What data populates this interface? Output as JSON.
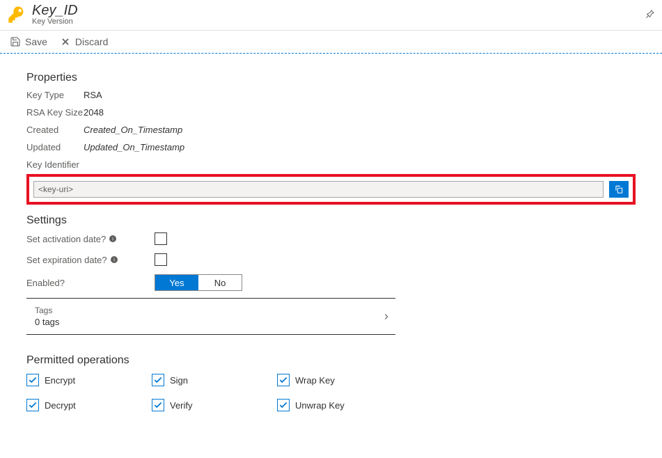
{
  "header": {
    "title": "Key_ID",
    "subtitle": "Key Version"
  },
  "toolbar": {
    "save": "Save",
    "discard": "Discard"
  },
  "properties": {
    "heading": "Properties",
    "key_type_label": "Key Type",
    "key_type_value": "RSA",
    "rsa_size_label": "RSA Key Size",
    "rsa_size_value": "2048",
    "created_label": "Created",
    "created_value": "Created_On_Timestamp",
    "updated_label": "Updated",
    "updated_value": "Updated_On_Timestamp",
    "key_identifier_label": "Key Identifier",
    "key_identifier_value": "<key-uri>"
  },
  "settings": {
    "heading": "Settings",
    "activation_label": "Set activation date?",
    "expiration_label": "Set expiration date?",
    "enabled_label": "Enabled?",
    "yes": "Yes",
    "no": "No"
  },
  "tags": {
    "label": "Tags",
    "count": "0 tags"
  },
  "permitted": {
    "heading": "Permitted operations",
    "ops": [
      "Encrypt",
      "Sign",
      "Wrap Key",
      "Decrypt",
      "Verify",
      "Unwrap Key"
    ]
  }
}
